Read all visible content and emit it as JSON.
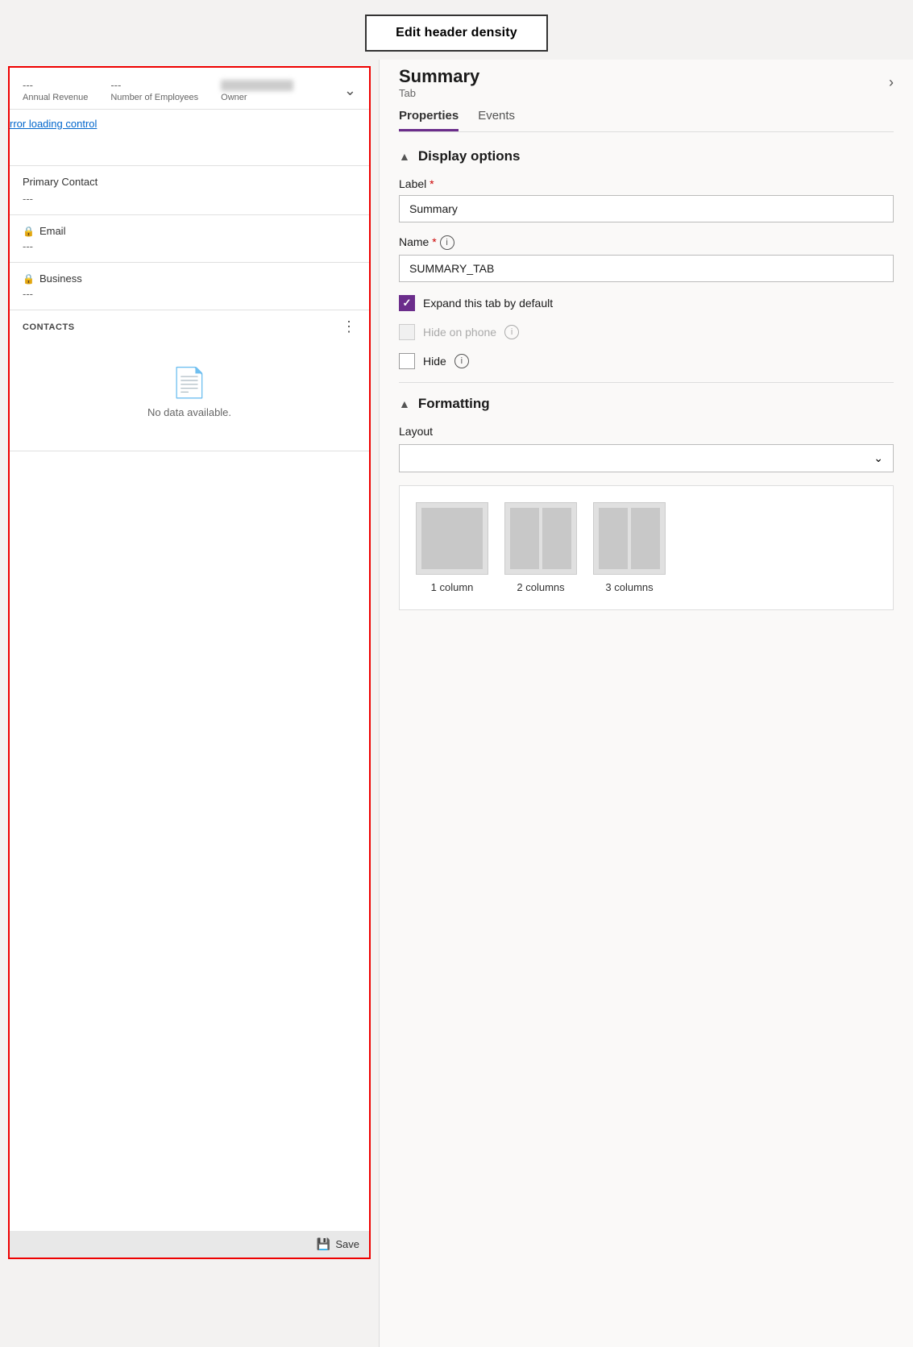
{
  "topbar": {
    "edit_header_btn": "Edit header density"
  },
  "left": {
    "header": {
      "annual_revenue": {
        "value": "---",
        "label": "Annual Revenue"
      },
      "number_of_employees": {
        "value": "---",
        "label": "Number of Employees"
      },
      "owner": {
        "label": "Owner"
      }
    },
    "error_text": "rror loading control",
    "primary_contact": {
      "label": "Primary Contact",
      "value": "---"
    },
    "email": {
      "label": "Email",
      "value": "---"
    },
    "business": {
      "label": "Business",
      "value": "---"
    },
    "contacts": {
      "title": "CONTACTS",
      "no_data": "No data available."
    },
    "save_button": "Save"
  },
  "right": {
    "panel_title": "Summary",
    "panel_subtitle": "Tab",
    "tabs": [
      {
        "label": "Properties",
        "active": true
      },
      {
        "label": "Events",
        "active": false
      }
    ],
    "display_options": {
      "section_title": "Display options",
      "label_field": {
        "label": "Label",
        "required": true,
        "value": "Summary"
      },
      "name_field": {
        "label": "Name",
        "required": true,
        "value": "SUMMARY_TAB"
      },
      "expand_tab": {
        "label": "Expand this tab by default",
        "checked": true
      },
      "hide_on_phone": {
        "label": "Hide on phone",
        "disabled": true,
        "checked": false
      },
      "hide": {
        "label": "Hide",
        "checked": false
      }
    },
    "formatting": {
      "section_title": "Formatting",
      "layout_label": "Layout",
      "options": [
        {
          "label": "1 column",
          "cols": 1
        },
        {
          "label": "2 columns",
          "cols": 2
        },
        {
          "label": "3 columns",
          "cols": 3
        }
      ]
    }
  }
}
